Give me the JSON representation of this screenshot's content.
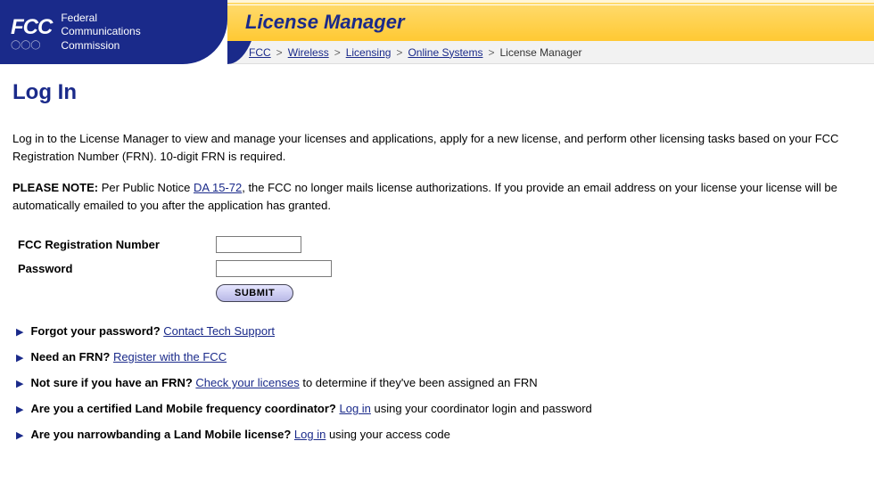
{
  "header": {
    "logo_abbrev": "FCC",
    "logo_line1": "Federal",
    "logo_line2": "Communications",
    "logo_line3": "Commission",
    "app_title": "License Manager"
  },
  "breadcrumb": {
    "items": [
      {
        "label": "FCC"
      },
      {
        "label": "Wireless"
      },
      {
        "label": "Licensing"
      },
      {
        "label": "Online Systems"
      }
    ],
    "current": "License Manager",
    "separator": ">"
  },
  "page": {
    "heading": "Log In",
    "intro": "Log in to the License Manager to view and manage your licenses and applications, apply for a new license, and perform other licensing tasks based on your FCC Registration Number (FRN). 10-digit FRN is required.",
    "note_prefix": "PLEASE NOTE:",
    "note_before_link": " Per Public Notice ",
    "note_link": "DA 15-72",
    "note_after_link": ", the FCC no longer mails license authorizations. If you provide an email address on your license your license will be automatically emailed to you after the application has granted."
  },
  "form": {
    "frn_label": "FCC Registration Number",
    "pwd_label": "Password",
    "submit_label": "SUBMIT"
  },
  "help": [
    {
      "bold": "Forgot your password?",
      "link": "Contact Tech Support",
      "after": ""
    },
    {
      "bold": "Need an FRN?",
      "link": "Register with the FCC",
      "after": "",
      "visited": true
    },
    {
      "bold": "Not sure if you have an FRN?",
      "link": "Check your licenses",
      "after": " to determine if they've been assigned an FRN"
    },
    {
      "bold": "Are you a certified Land Mobile frequency coordinator?",
      "link": "Log in",
      "after": " using your coordinator login and password"
    },
    {
      "bold": "Are you narrowbanding a Land Mobile license?",
      "link": "Log in",
      "after": " using your access code"
    }
  ]
}
